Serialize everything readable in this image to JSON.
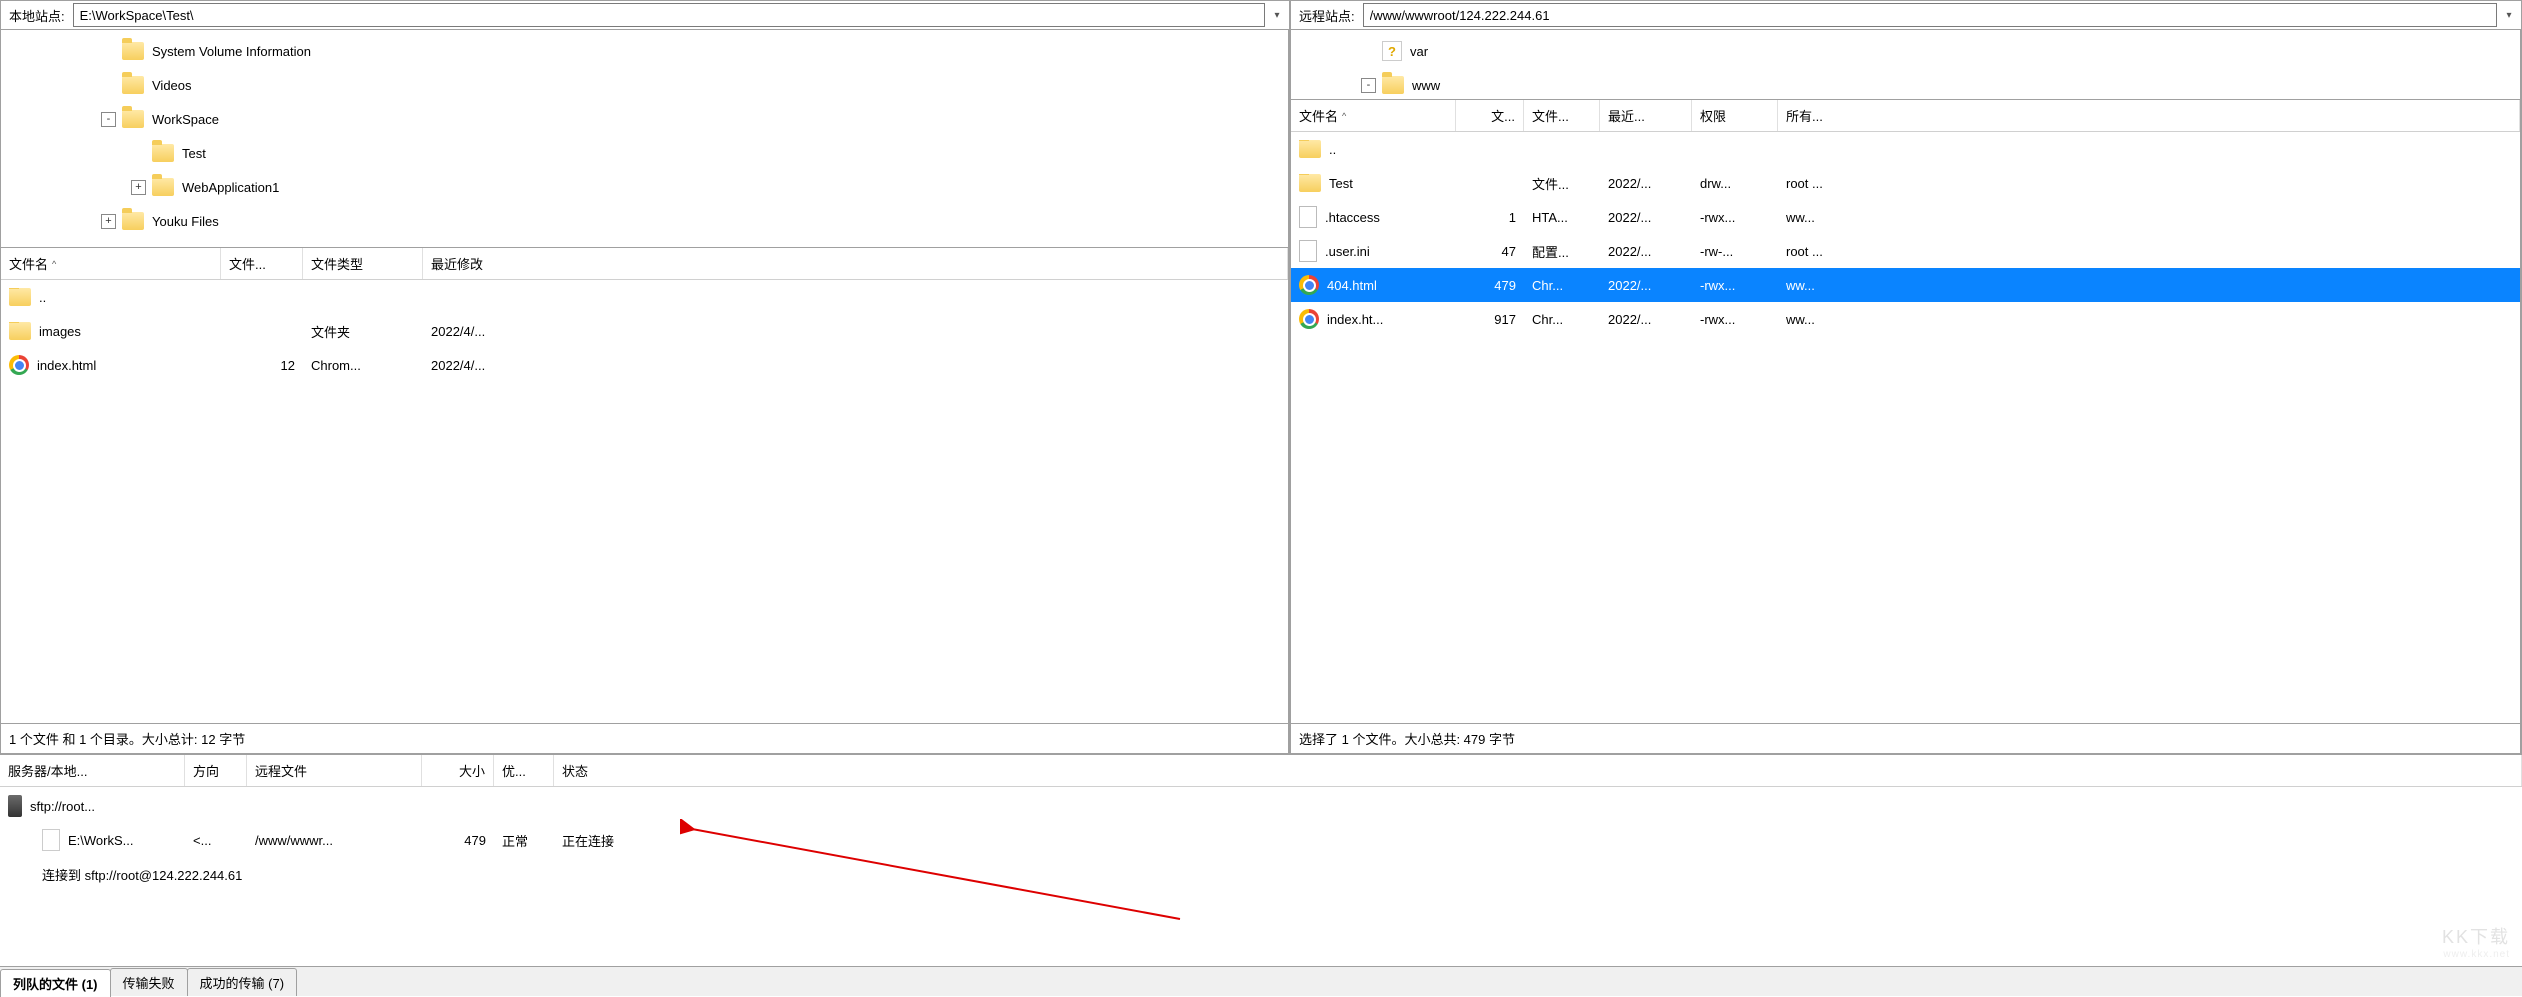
{
  "local": {
    "addr_label": "本地站点:",
    "addr_value": "E:\\WorkSpace\\Test\\",
    "tree": [
      {
        "indent": 3,
        "exp": "",
        "icon": "folder",
        "label": "System Volume Information"
      },
      {
        "indent": 3,
        "exp": "",
        "icon": "folder",
        "label": "Videos"
      },
      {
        "indent": 3,
        "exp": "-",
        "icon": "folder",
        "label": "WorkSpace"
      },
      {
        "indent": 4,
        "exp": "",
        "icon": "folder",
        "label": "Test"
      },
      {
        "indent": 4,
        "exp": "+",
        "icon": "folder",
        "label": "WebApplication1"
      },
      {
        "indent": 3,
        "exp": "+",
        "icon": "folder",
        "label": "Youku Files"
      }
    ],
    "columns": {
      "name": "文件名",
      "size": "文件...",
      "type": "文件类型",
      "mod": "最近修改"
    },
    "rows": [
      {
        "icon": "folder",
        "name": "..",
        "size": "",
        "type": "",
        "mod": ""
      },
      {
        "icon": "folder",
        "name": "images",
        "size": "",
        "type": "文件夹",
        "mod": "2022/4/..."
      },
      {
        "icon": "chrome",
        "name": "index.html",
        "size": "12",
        "type": "Chrom...",
        "mod": "2022/4/..."
      }
    ],
    "status": "1 个文件 和 1 个目录。大小总计: 12 字节"
  },
  "remote": {
    "addr_label": "远程站点:",
    "addr_value": "/www/wwwroot/124.222.244.61",
    "tree": [
      {
        "indent": 2,
        "exp": "",
        "icon": "unknown",
        "label": "var"
      },
      {
        "indent": 2,
        "exp": "-",
        "icon": "folder",
        "label": "www"
      }
    ],
    "columns": {
      "name": "文件名",
      "size": "文...",
      "type": "文件...",
      "mod": "最近...",
      "perm": "权限",
      "own": "所有..."
    },
    "rows": [
      {
        "icon": "folder",
        "name": "..",
        "size": "",
        "type": "",
        "mod": "",
        "perm": "",
        "own": "",
        "sel": false
      },
      {
        "icon": "folder",
        "name": "Test",
        "size": "",
        "type": "文件...",
        "mod": "2022/...",
        "perm": "drw...",
        "own": "root ...",
        "sel": false
      },
      {
        "icon": "file",
        "name": ".htaccess",
        "size": "1",
        "type": "HTA...",
        "mod": "2022/...",
        "perm": "-rwx...",
        "own": "ww...",
        "sel": false
      },
      {
        "icon": "file",
        "name": ".user.ini",
        "size": "47",
        "type": "配置...",
        "mod": "2022/...",
        "perm": "-rw-...",
        "own": "root ...",
        "sel": false
      },
      {
        "icon": "chrome",
        "name": "404.html",
        "size": "479",
        "type": "Chr...",
        "mod": "2022/...",
        "perm": "-rwx...",
        "own": "ww...",
        "sel": true
      },
      {
        "icon": "chrome",
        "name": "index.ht...",
        "size": "917",
        "type": "Chr...",
        "mod": "2022/...",
        "perm": "-rwx...",
        "own": "ww...",
        "sel": false
      }
    ],
    "status": "选择了 1 个文件。大小总共: 479 字节"
  },
  "queue": {
    "columns": {
      "srv": "服务器/本地...",
      "dir": "方向",
      "rem": "远程文件",
      "size": "大小",
      "pri": "优...",
      "sta": "状态"
    },
    "rows": [
      {
        "type": "server",
        "srv": "sftp://root...",
        "dir": "",
        "rem": "",
        "size": "",
        "pri": "",
        "sta": ""
      },
      {
        "type": "item",
        "srv": "E:\\WorkS...",
        "dir": "<...",
        "rem": "/www/wwwr...",
        "size": "479",
        "pri": "正常",
        "sta": "正在连接"
      },
      {
        "type": "msg",
        "srv": "连接到 sftp://root@124.222.244.61",
        "dir": "",
        "rem": "",
        "size": "",
        "pri": "",
        "sta": ""
      }
    ]
  },
  "tabs": {
    "queued": "列队的文件 (1)",
    "failed": "传输失败",
    "success": "成功的传输 (7)"
  },
  "watermark": {
    "main": "KK下载",
    "sub": "www.kkx.net"
  }
}
